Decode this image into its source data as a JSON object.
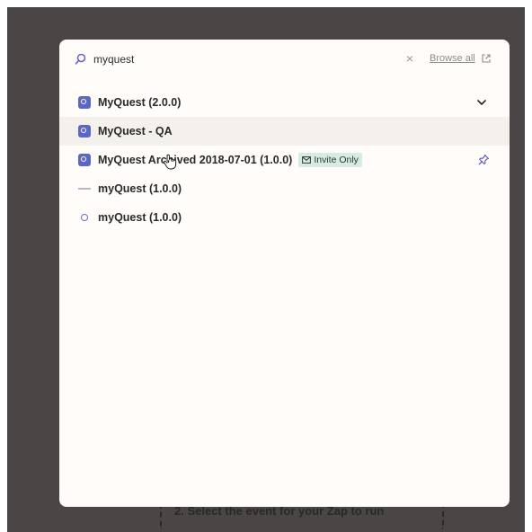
{
  "background": {
    "step_text": "2. Select the event for your Zap to run"
  },
  "search": {
    "value": "myquest",
    "placeholder": "",
    "browse_all": "Browse all"
  },
  "results": [
    {
      "label": "MyQuest (2.0.0)"
    },
    {
      "label": "MyQuest - QA"
    },
    {
      "label": "MyQuest Archived 2018-07-01 (1.0.0)",
      "badge": "Invite Only"
    },
    {
      "label": "myQuest (1.0.0)"
    },
    {
      "label": "myQuest (1.0.0)"
    }
  ],
  "colors": {
    "accent": "#5a67c4",
    "badge_bg": "#d6ebe2",
    "overlay": "#4a4646",
    "modal_bg": "#fffcf9"
  },
  "icons": [
    "search-icon",
    "close-icon",
    "external-link-icon",
    "app-icon",
    "chevron-down-icon",
    "envelope-icon",
    "pin-icon",
    "dash-icon"
  ]
}
